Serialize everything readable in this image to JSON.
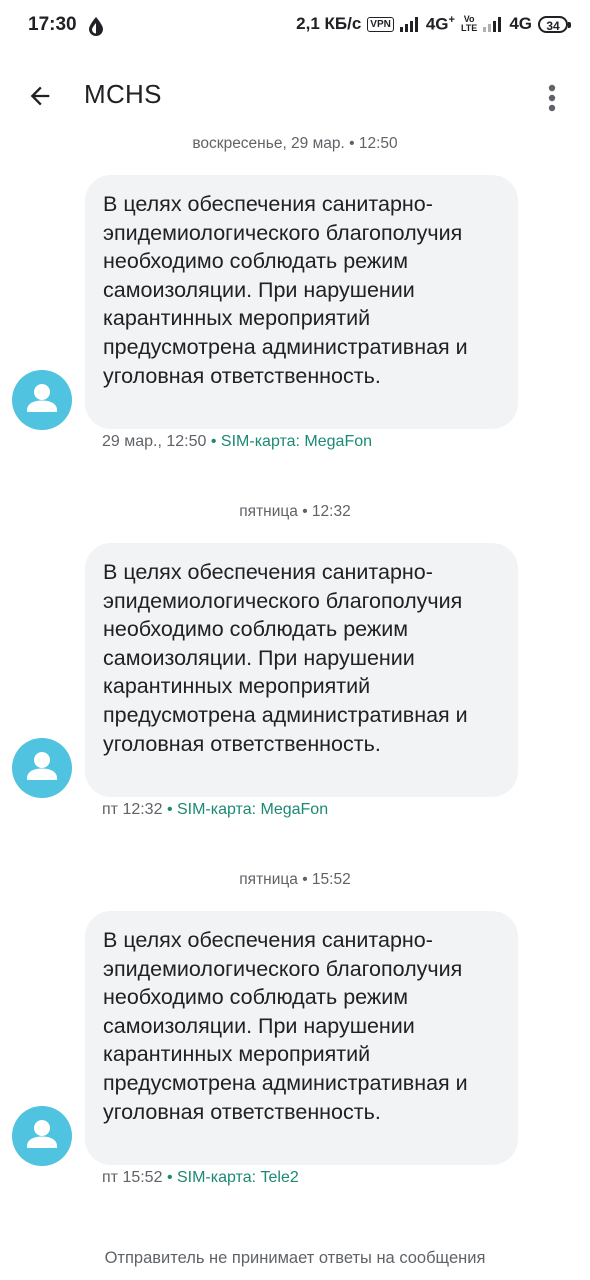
{
  "status_bar": {
    "time": "17:30",
    "speed": "2,1 КБ/с",
    "vpn": "VPN",
    "network1": "4G",
    "network1_plus": "+",
    "volte_top": "Vo",
    "volte_bottom": "LTE",
    "network2": "4G",
    "battery": "34"
  },
  "header": {
    "title": "MCHS"
  },
  "messages": [
    {
      "date_separator": "воскресенье, 29 мар. • 12:50",
      "text": "В целях обеспечения санитарно-эпидемиологического благополучия необходимо соблюдать режим самоизоляции. При нарушении карантинных мероприятий предусмотрена административная и уголовная ответственность.",
      "timestamp": "29 мар., 12:50",
      "sim": "• SIM-карта: MegaFon"
    },
    {
      "date_separator": "пятница • 12:32",
      "text": "В целях обеспечения санитарно-эпидемиологического благополучия необходимо соблюдать режим самоизоляции. При нарушении карантинных мероприятий предусмотрена административная и уголовная ответственность.",
      "timestamp": "пт 12:32",
      "sim": "• SIM-карта: MegaFon"
    },
    {
      "date_separator": "пятница • 15:52",
      "text": "В целях обеспечения санитарно-эпидемиологического благополучия необходимо соблюдать режим самоизоляции. При нарушении карантинных мероприятий предусмотрена административная и уголовная ответственность.",
      "timestamp": "пт 15:52",
      "sim": "• SIM-карта: Tele2"
    }
  ],
  "footer": {
    "note": "Отправитель не принимает ответы на сообщения"
  },
  "icons": {
    "back": "arrow-back-icon",
    "more": "more-vertical-icon",
    "avatar": "person-icon",
    "drop": "drop-icon"
  },
  "colors": {
    "avatar": "#4fc3e0",
    "bubble": "#f1f3f4",
    "sim_text": "#1b8a72",
    "meta_text": "#5f6368"
  }
}
